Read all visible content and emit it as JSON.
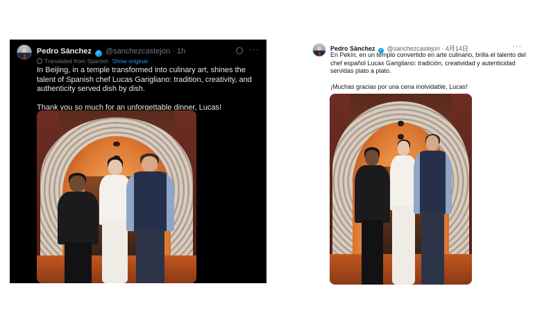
{
  "dark_tweet": {
    "author_name": "Pedro Sánchez",
    "verified_mark": "✓",
    "handle": "@sanchezcastejon",
    "separator": "·",
    "time": "1h",
    "more": "···",
    "translated_label": "Translated from Spanish",
    "show_original": "Show original",
    "text_line1": "In Beijing, in a temple transformed into culinary art, shines the talent of Spanish chef Lucas Garigliano: tradition, creativity, and authenticity served dish by dish.",
    "text_line2": "Thank you so much for an unforgettable dinner, Lucas!",
    "icons": [
      "avatar",
      "verified-icon",
      "grok-icon",
      "more-icon",
      "globe-icon"
    ]
  },
  "light_tweet": {
    "author_name": "Pedro Sánchez",
    "verified_mark": "✓",
    "handle": "@sanchezcastejon",
    "separator": "·",
    "time": "4月14日",
    "more": "···",
    "text_line1": "En Pekín, en un templo convertido en arte culinario, brilla el talento del chef español Lucas Garigliano: tradición, creatividad y autenticidad servidas plato a plato.",
    "text_line2": "¡Muchas gracias por una cena inolvidable, Lucas!"
  },
  "colors": {
    "dark_bg": "#000000",
    "dark_text": "#e7e9ea",
    "muted": "#71767b",
    "link": "#1d9bf0",
    "light_text": "#0f1419"
  }
}
